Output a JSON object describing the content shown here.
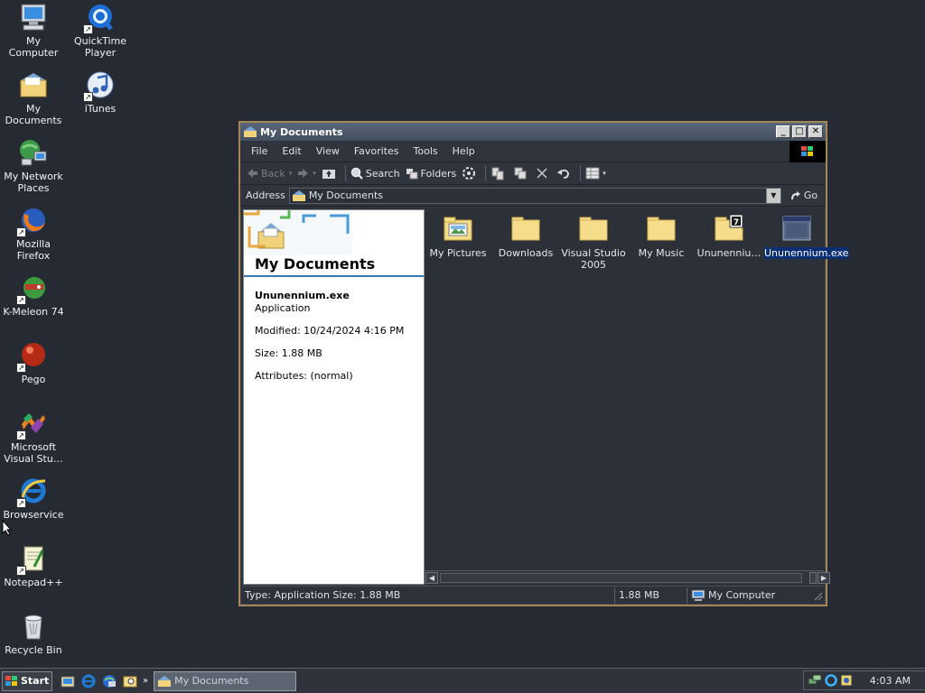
{
  "desktop": {
    "icons": [
      {
        "label": "My Computer",
        "icon": "computer-icon"
      },
      {
        "label": "QuickTime Player",
        "icon": "quicktime-icon"
      },
      {
        "label": "My Documents",
        "icon": "my-documents-folder-icon"
      },
      {
        "label": "iTunes",
        "icon": "itunes-icon"
      },
      {
        "label": "My Network Places",
        "icon": "network-places-icon"
      },
      {
        "label": "Mozilla Firefox",
        "icon": "firefox-icon"
      },
      {
        "label": "K-Meleon 74",
        "icon": "k-meleon-icon"
      },
      {
        "label": "Pego",
        "icon": "pego-icon"
      },
      {
        "label": "Microsoft Visual Stu…",
        "icon": "visual-studio-icon"
      },
      {
        "label": "Browservice",
        "icon": "internet-explorer-icon"
      },
      {
        "label": "Notepad++",
        "icon": "notepad-plus-plus-icon"
      },
      {
        "label": "Recycle Bin",
        "icon": "recycle-bin-icon"
      }
    ]
  },
  "window": {
    "title": "My Documents",
    "menu": [
      "File",
      "Edit",
      "View",
      "Favorites",
      "Tools",
      "Help"
    ],
    "toolbar": {
      "back": "Back",
      "search": "Search",
      "folders": "Folders"
    },
    "address": {
      "label": "Address",
      "value": "My Documents",
      "go": "Go"
    },
    "taskpane": {
      "title": "My Documents",
      "file_name": "Ununennium.exe",
      "file_type": "Application",
      "modified": "Modified: 10/24/2024 4:16 PM",
      "size": "Size: 1.88 MB",
      "attributes": "Attributes: (normal)"
    },
    "files": [
      {
        "label": "My Pictures",
        "icon": "pictures-folder-icon"
      },
      {
        "label": "Downloads",
        "icon": "folder-icon"
      },
      {
        "label": "Visual Studio 2005",
        "icon": "folder-icon"
      },
      {
        "label": "My Music",
        "icon": "folder-icon"
      },
      {
        "label": "Ununenniu…",
        "icon": "7zip-folder-icon"
      },
      {
        "label": "Ununennium.exe",
        "icon": "application-icon",
        "selected": true
      }
    ],
    "status": {
      "left": "Type: Application Size: 1.88 MB",
      "size": "1.88 MB",
      "zone": "My Computer"
    }
  },
  "taskbar": {
    "start": "Start",
    "task": "My Documents",
    "clock": "4:03 AM"
  },
  "colors": {
    "desktop": "#262a33",
    "window_border": "#a4885a",
    "selection": "#0b2f74"
  }
}
